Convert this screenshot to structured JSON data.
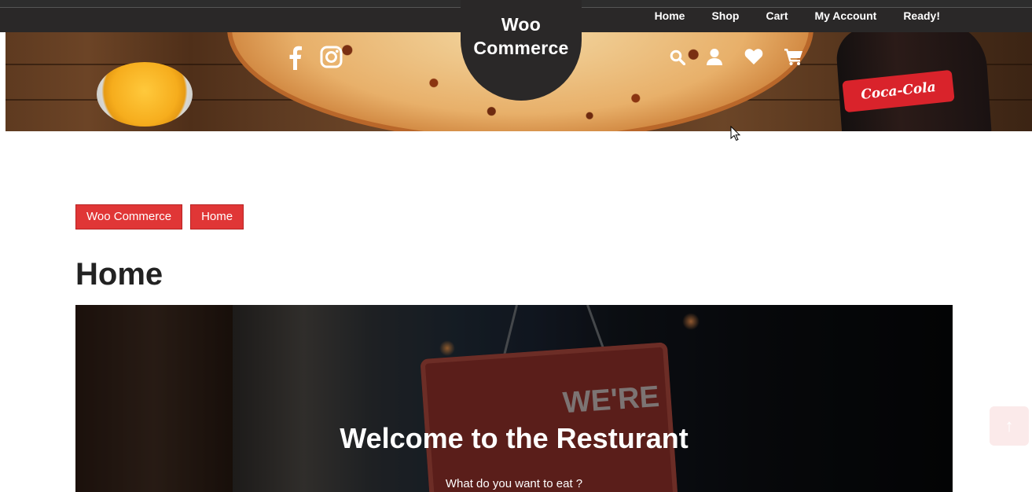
{
  "nav": {
    "items": [
      "Home",
      "Shop",
      "Cart",
      "My Account",
      "Ready!"
    ]
  },
  "logo": {
    "line1": "Woo",
    "line2": "Commerce"
  },
  "icons": {
    "left": [
      "facebook-icon",
      "instagram-icon"
    ],
    "right": [
      "search-icon",
      "user-icon",
      "heart-icon",
      "cart-icon"
    ]
  },
  "banner": {
    "bottle_label": "Coca-Cola"
  },
  "breadcrumb": {
    "items": [
      "Woo Commerce",
      "Home"
    ]
  },
  "page": {
    "title": "Home"
  },
  "hero": {
    "title": "Welcome to the Resturant",
    "subtitle": "What do you want to eat ?",
    "sign_text": "WE'RE"
  },
  "colors": {
    "topbar": "#2a2828",
    "accent": "#e03636",
    "text_dark": "#222222"
  }
}
